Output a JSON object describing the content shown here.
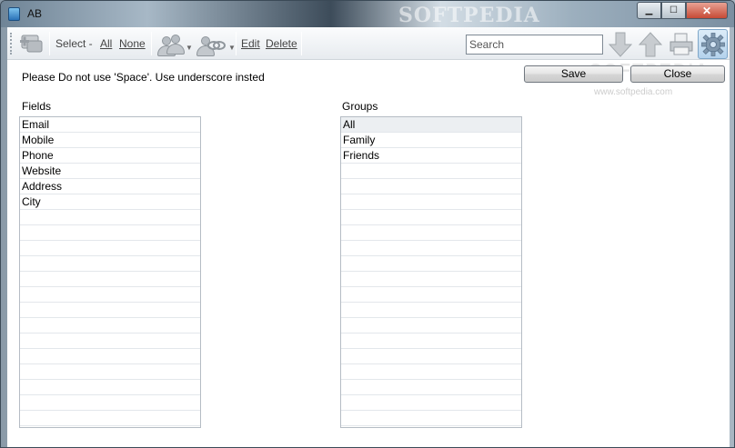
{
  "window": {
    "title": "AB",
    "brand_watermark": "SOFTPEDIA",
    "close_glyph": "✕",
    "max_glyph": "☐",
    "min_glyph": "▁"
  },
  "toolbar": {
    "select_label": "Select -",
    "all_label": "All",
    "none_label": "None",
    "edit_label": "Edit",
    "delete_label": "Delete",
    "search_placeholder": "Search"
  },
  "note": "Please Do not use 'Space'. Use underscore insted",
  "buttons": {
    "save": "Save",
    "close": "Close"
  },
  "watermark": {
    "text": "SOFTPEDIA",
    "url": "www.softpedia.com"
  },
  "fields": {
    "label": "Fields",
    "items": [
      "Email",
      "Mobile",
      "Phone",
      "Website",
      "Address",
      "City"
    ]
  },
  "groups": {
    "label": "Groups",
    "items": [
      "All",
      "Family",
      "Friends"
    ],
    "selected": "All"
  },
  "icons": {
    "add_contact": "add-contact-icon",
    "contact_group": "contacts-icon",
    "contact_link": "link-contacts-icon",
    "move_down": "arrow-down-icon",
    "move_up": "arrow-up-icon",
    "print": "printer-icon",
    "settings": "gear-icon"
  }
}
